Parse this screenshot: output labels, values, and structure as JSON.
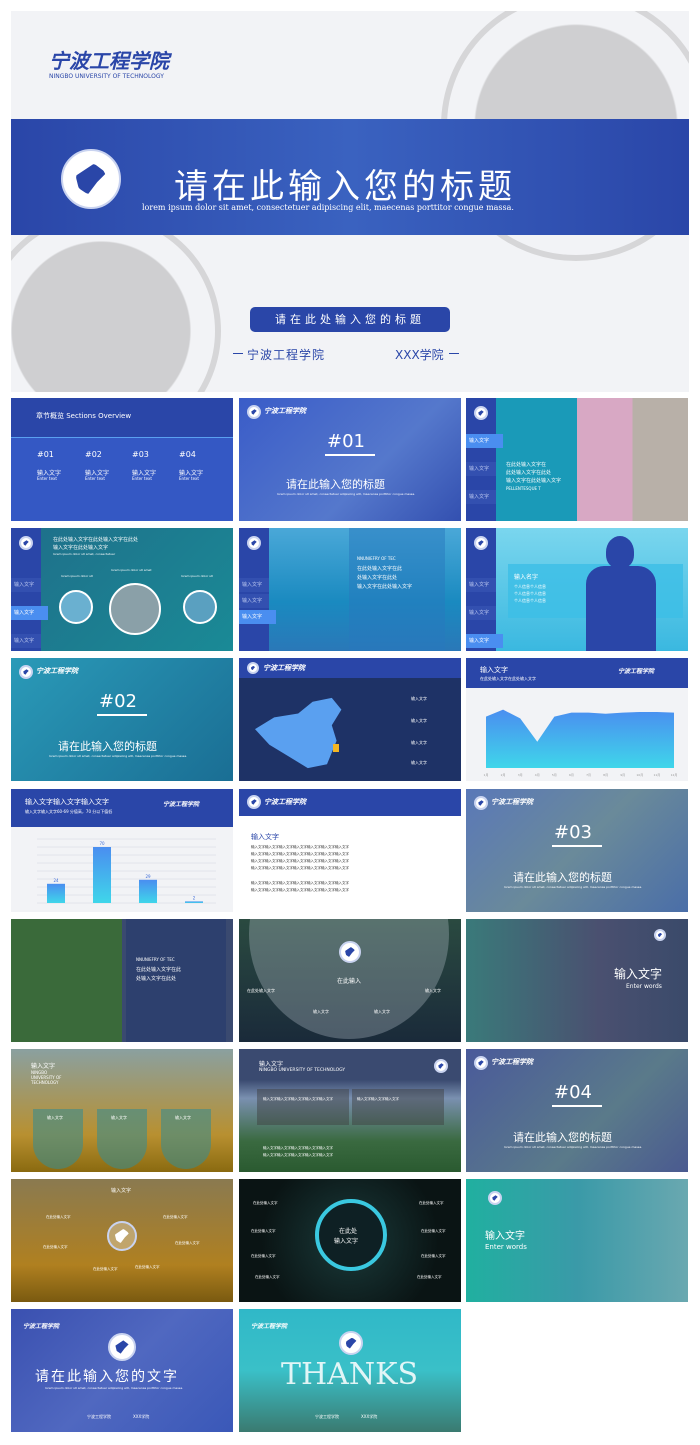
{
  "hero": {
    "logo_text": "宁波工程学院",
    "logo_sub": "NINGBO UNIVERSITY OF TECHNOLOGY",
    "title": "请在此输入您的标题",
    "subtitle": "lorem ipsum dolor sit amet, consectetuer adipiscing elit, maecenas porttitor congue massa.",
    "button": "请在此处输入您的标题",
    "school": "宁波工程学院",
    "college": "XXX学院",
    "colors": {
      "primary": "#2a46a8",
      "background": "#f2f3f6"
    }
  },
  "common": {
    "logo_text": "宁波工程学院",
    "logo_sub": "NINGBO UNIVERSITY OF TECHNOLOGY",
    "enter_text": "输入文字",
    "enter_text_en": "Enter text",
    "lorem_short": "lorem ipsum dolor sit amet, consectetuer adipiscing elit, maecenas porttitor congue massa.",
    "section_title": "请在此输入您的标题"
  },
  "s1": {
    "title": "章节概览 Sections Overview",
    "items": [
      {
        "num": "#01"
      },
      {
        "num": "#02"
      },
      {
        "num": "#03"
      },
      {
        "num": "#04"
      }
    ]
  },
  "s2": {
    "num": "#01"
  },
  "s3": {
    "side": [
      "输入文字",
      "输入文字",
      "输入文字",
      "输入文字"
    ],
    "lines": [
      "在此处输入文字在",
      "此处输入文字在此处",
      "输入文字在此处输入文字"
    ],
    "en": "PELLENTESQUE T"
  },
  "s4": {
    "title": [
      "在此处输入文字在此处输入文字在此处",
      "输入文字在此处输入文字"
    ],
    "sub": "lorem ipsum dolor sit amet, consectetuer",
    "labels": [
      "lorem ipsum dolor sit",
      "lorem ipsum dolor sit amet",
      "lorem ipsum dolor sit"
    ],
    "side": [
      "输入文字",
      "输入文字",
      "输入文字",
      "输入文字"
    ]
  },
  "s5": {
    "en": "NNUNIEFRY OF TEC",
    "lines": [
      "在此处输入文字在此",
      "处输入文字在此处",
      "输入文字在此处输入文字"
    ],
    "side": [
      "输入文字",
      "输入文字",
      "输入文字",
      "输入文字"
    ]
  },
  "s6": {
    "name": "输入名字",
    "info": [
      "个人信息个人信息",
      "个人信息个人信息",
      "个人信息个人信息"
    ],
    "side": [
      "输入文字",
      "输入文字",
      "输入文字",
      "输入文字"
    ]
  },
  "s7": {
    "num": "#02"
  },
  "s8": {
    "labels": [
      "输入文字",
      "输入文字",
      "输入文字",
      "输入文字"
    ],
    "highlight": "#f5b622"
  },
  "s9": {
    "title": "输入文字",
    "sub": "在此处输入文字在此处输入文字"
  },
  "s10": {
    "title": "输入文字输入文字输入文字",
    "sub": "输入文字输入文字60-69 分值高，70 分以下值低"
  },
  "s11": {
    "title": "输入文字",
    "para1": [
      "输入文字输入文字输入文字输入文字输入文字输入文字输入文字",
      "输入文字输入文字输入文字输入文字输入文字输入文字输入文字",
      "输入文字输入文字输入文字输入文字输入文字输入文字输入文字",
      "输入文字输入文字输入文字输入文字输入文字输入文字输入文字"
    ],
    "para2": [
      "输入文字输入文字输入文字输入文字输入文字输入文字输入文字",
      "输入文字输入文字输入文字输入文字输入文字输入文字输入文字"
    ]
  },
  "s12": {
    "num": "#03"
  },
  "s13": {
    "en": "NNUNIEFRY OF TEC",
    "lines": [
      "在此处输入文字在此",
      "处输入文字在此处"
    ]
  },
  "s14": {
    "center": "在此输入",
    "items": [
      "在此处输入文字",
      "输入文字",
      "输入文字",
      "输入文字"
    ]
  },
  "s15": {
    "title": "输入文字",
    "en": "Enter words"
  },
  "s16": {
    "title": "输入文字",
    "en": [
      "NINGBO",
      "UNIVERSITY OF",
      "TECHNOLOGY"
    ],
    "items": [
      "输入文字",
      "输入文字",
      "输入文字"
    ]
  },
  "s17": {
    "title": "输入文字",
    "en": "NINGBO UNIVERSITY OF TECHNOLOGY",
    "box1": "输入文字输入文字输入文字输入文字输入文字",
    "box2": "输入文字输入文字输入文字",
    "bottom": [
      "输入文字输入文字输入文字输入文字输入文字",
      "输入文字输入文字输入文字输入文字输入文字"
    ]
  },
  "s18": {
    "num": "#04"
  },
  "s19": {
    "title": "输入文字",
    "items": [
      "在此处输入文字",
      "在此处输入文字",
      "在此处输入文字",
      "在此处输入文字",
      "在此处输入文字",
      "在此处输入文字"
    ]
  },
  "s20": {
    "center": [
      "在此处",
      "输入文字"
    ],
    "left": [
      "在此处输入文字",
      "在此处输入文字",
      "在此处输入文字",
      "在此处输入文字"
    ],
    "right": [
      "在此处输入文字",
      "在此处输入文字",
      "在此处输入文字",
      "在此处输入文字"
    ]
  },
  "s21": {
    "title": "输入文字",
    "en": "Enter words"
  },
  "s22": {
    "title": "请在此输入您的文字",
    "school": "宁波工程学院",
    "college": "XXX学院"
  },
  "s23": {
    "title": "THANKS",
    "school": "宁波工程学院",
    "college": "XXX学院"
  },
  "chart_data": [
    {
      "type": "area",
      "title": "输入文字",
      "x": [
        "1月",
        "2月",
        "3月",
        "4月",
        "5月",
        "6月",
        "7月",
        "8月",
        "9月",
        "10月",
        "11月",
        "12月"
      ],
      "values": [
        88,
        100,
        85,
        45,
        88,
        95,
        95,
        93,
        95,
        96,
        96,
        95
      ],
      "ylim": [
        0,
        120
      ],
      "colors": [
        "#4a8ef0",
        "#3fd6ea"
      ]
    },
    {
      "type": "bar",
      "title": "输入文字输入文字输入文字",
      "categories": [
        "",
        "",
        "",
        ""
      ],
      "values": [
        24,
        70,
        29,
        2
      ],
      "ylim": [
        0,
        80
      ],
      "grid": true,
      "colors": [
        "#4a8ef0",
        "#3fd6ea"
      ]
    }
  ]
}
